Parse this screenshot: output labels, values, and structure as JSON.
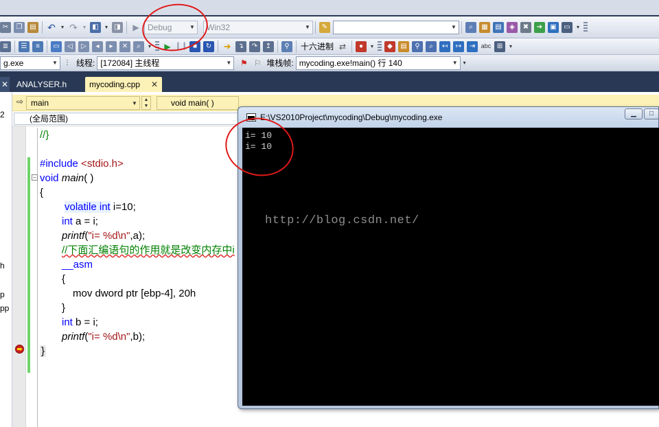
{
  "toolbar1": {
    "config_combo": "Debug",
    "platform_combo": "Win32",
    "find_combo": ""
  },
  "toolbar2": {
    "hex_label": "十六进制"
  },
  "toolbar3": {
    "process_combo": "g.exe",
    "thread_label": "线程:",
    "thread_combo": "[172084] 主线程",
    "stack_label": "堆栈帧:",
    "stack_combo": "mycoding.exe!main()  行 140"
  },
  "tabs": [
    {
      "label": "ANALYSER.h"
    },
    {
      "label": "mycoding.cpp"
    }
  ],
  "nav": {
    "scope_combo": "main",
    "function_combo": "void main( )",
    "scope_text": "(全局范围)"
  },
  "left_panel": [
    "2",
    "h",
    "p",
    "pp"
  ],
  "code": {
    "l0": "//}",
    "l1_pp": "#include",
    "l1_rest": " <stdio.h>",
    "l2_kw": "void",
    "l2_fn": "main",
    "l2_rest": "( )",
    "l3": "{",
    "l4_kw": "volatile int",
    "l4_rest": " i=10;",
    "l5_kw": "int",
    "l5_rest": " a = i;",
    "l6_fn": "printf",
    "l6_str": "\"i= %d\\n\"",
    "l6_rest": ",a);",
    "l7_cm": "//下面汇编语句的作用就是改变内存中i",
    "l8_kw": "__asm",
    "l9": "{",
    "l10_kw": "mov dword ptr",
    "l10_rest": " [ebp-4], 20h",
    "l11": "}",
    "l12_kw": "int",
    "l12_rest": " b = i;",
    "l13_fn": "printf",
    "l13_str": "\"i= %d\\n\"",
    "l13_rest": ",b);",
    "l14": "}"
  },
  "console": {
    "title": "E:\\VS2010Project\\mycoding\\Debug\\mycoding.exe",
    "lines": [
      "i= 10",
      "i= 10"
    ]
  },
  "watermark": "http://blog.csdn.net/",
  "colors": {
    "ide_background": "#293955",
    "active_tab": "#fcf1b6",
    "annotation": "#e01818",
    "console_bg": "#000000"
  }
}
